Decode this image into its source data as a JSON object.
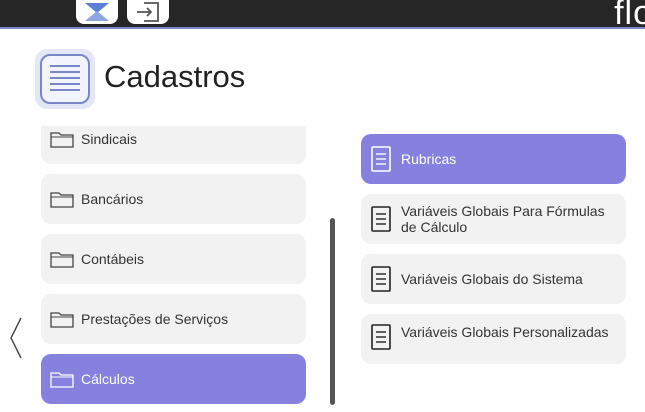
{
  "topbar": {
    "brand": "flo"
  },
  "page": {
    "title": "Cadastros"
  },
  "categories": [
    {
      "label": "Sindicais"
    },
    {
      "label": "Bancários"
    },
    {
      "label": "Contábeis"
    },
    {
      "label": "Prestações de Serviços"
    },
    {
      "label": "Cálculos",
      "active": true
    }
  ],
  "subitems": [
    {
      "label": "Rubricas",
      "active": true
    },
    {
      "label": "Variáveis Globais Para Fórmulas de Cálculo"
    },
    {
      "label": "Variáveis Globais do Sistema"
    },
    {
      "label": "Variáveis Globais Personalizadas"
    }
  ],
  "colors": {
    "accent": "#8681de",
    "item_bg": "#f2f2f2",
    "topbar": "#262626"
  }
}
